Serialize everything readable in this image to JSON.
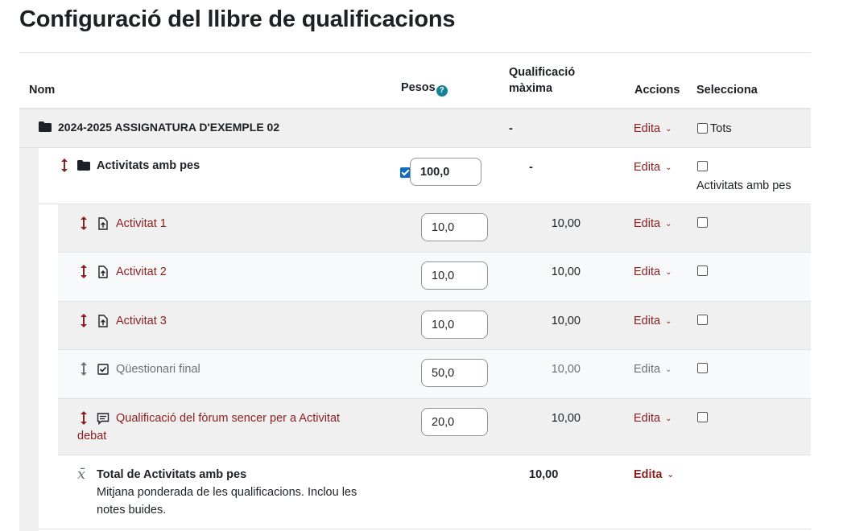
{
  "page": {
    "title": "Configuració del llibre de qualificacions"
  },
  "headers": {
    "name": "Nom",
    "weights": "Pesos",
    "max_grade_line1": "Qualificació",
    "max_grade_line2": "màxima",
    "actions": "Accions",
    "select": "Selecciona"
  },
  "course": {
    "name": "2024-2025 ASSIGNATURA D'EXEMPLE 02",
    "max_grade": "-",
    "edit": "Edita",
    "select_all": "Tots"
  },
  "category": {
    "name": "Activitats amb pes",
    "weight": "100,0",
    "weight_checked": true,
    "max_grade": "-",
    "edit": "Edita",
    "select_label": "Activitats amb pes"
  },
  "items": [
    {
      "name": "Activitat 1",
      "weight": "10,0",
      "max_grade": "10,00",
      "edit": "Edita",
      "icon": "assignment-icon",
      "hidden": false
    },
    {
      "name": "Activitat 2",
      "weight": "10,0",
      "max_grade": "10,00",
      "edit": "Edita",
      "icon": "assignment-icon",
      "hidden": false
    },
    {
      "name": "Activitat 3",
      "weight": "10,0",
      "max_grade": "10,00",
      "edit": "Edita",
      "icon": "assignment-icon",
      "hidden": false
    },
    {
      "name": "Qüestionari final",
      "weight": "50,0",
      "max_grade": "10,00",
      "edit": "Edita",
      "icon": "quiz-icon",
      "hidden": true
    },
    {
      "name_line1": "Qualificació del fòrum sencer per a Activitat",
      "name_line2": "debat",
      "weight": "20,0",
      "max_grade": "10,00",
      "edit": "Edita",
      "icon": "forum-icon",
      "hidden": false
    }
  ],
  "total": {
    "name": "Total de Activitats amb pes",
    "desc_line1": "Mitjana ponderada de les qualificacions. Inclou les",
    "desc_line2": "notes buides.",
    "max_grade": "10,00",
    "edit": "Edita"
  },
  "colors": {
    "link": "#8c1e1e",
    "muted": "#6a737b",
    "help": "#138496",
    "row_grey": "#f0f0f0"
  }
}
